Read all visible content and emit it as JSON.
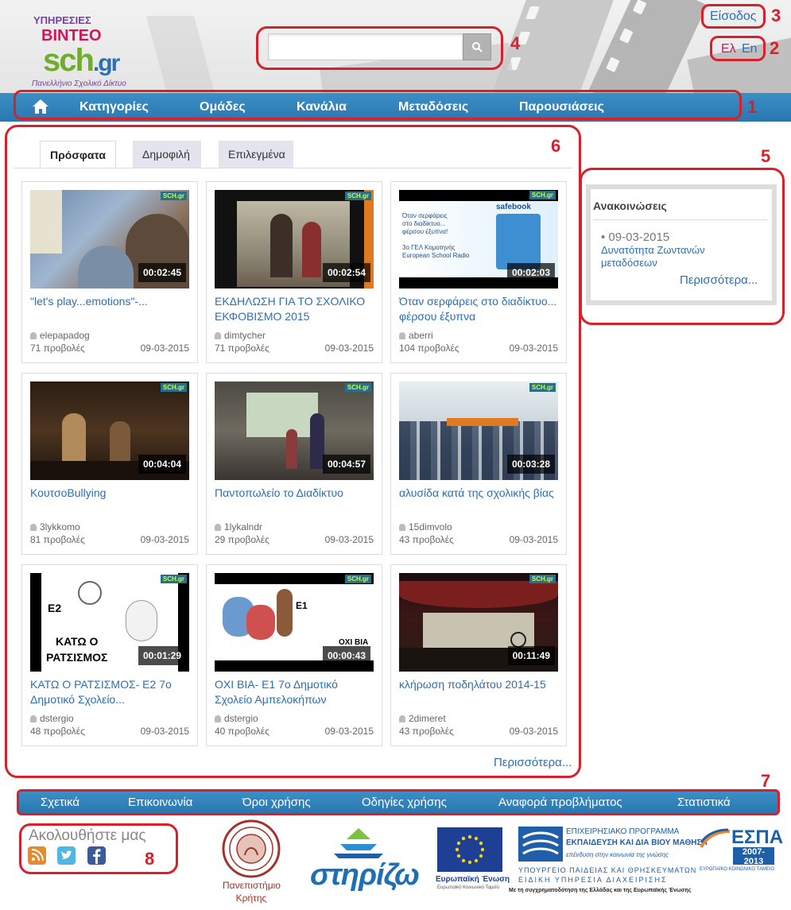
{
  "logo": {
    "line1": "ΥΠΗΡΕΣΙΕΣ",
    "line2": "ΒΙΝΤΕΟ",
    "line3": "sch",
    "line3b": ".gr",
    "tagline": "Πανελλήνιο Σχολικό Δίκτυο"
  },
  "header": {
    "login_label": "Είσοδος",
    "lang_el": "Ελ",
    "lang_en": "En",
    "search_placeholder": ""
  },
  "nav": {
    "items": [
      "Κατηγορίες",
      "Ομάδες",
      "Κανάλια",
      "Μεταδόσεις",
      "Παρουσιάσεις"
    ]
  },
  "tabs": [
    {
      "label": "Πρόσφατα",
      "active": true
    },
    {
      "label": "Δημοφιλή",
      "active": false
    },
    {
      "label": "Επιλεγμένα",
      "active": false
    }
  ],
  "videos": [
    {
      "title": "\"let's play...emotions\"-...",
      "author": "elepapadog",
      "views": "71 προβολές",
      "date": "09-03-2015",
      "duration": "00:02:45"
    },
    {
      "title": "ΕΚΔΗΛΩΣΗ ΓΙΑ ΤΟ ΣΧΟΛΙΚΟ ΕΚΦΟΒΙΣΜΟ 2015",
      "author": "dimtycher",
      "views": "71 προβολές",
      "date": "09-03-2015",
      "duration": "00:02:54"
    },
    {
      "title": "Όταν σερφάρεις στο διαδίκτυο... φέρσου έξυπνα",
      "author": "aberri",
      "views": "104 προβολές",
      "date": "09-03-2015",
      "duration": "00:02:03"
    },
    {
      "title": "ΚουτσοBullying",
      "author": "3lykkomo",
      "views": "81 προβολές",
      "date": "09-03-2015",
      "duration": "00:04:04"
    },
    {
      "title": "Παντοπωλείο το Διαδίκτυο",
      "author": "1lykalndr",
      "views": "29 προβολές",
      "date": "09-03-2015",
      "duration": "00:04:57"
    },
    {
      "title": "αλυσίδα κατά της σχολικής βίας",
      "author": "15dimvolo",
      "views": "43 προβολές",
      "date": "09-03-2015",
      "duration": "00:03:28"
    },
    {
      "title": "ΚΑΤΩ Ο ΡΑΤΣΙΣΜΟΣ- Ε2 7ο Δημοτικό Σχολείο...",
      "author": "dstergio",
      "views": "48 προβολές",
      "date": "09-03-2015",
      "duration": "00:01:29"
    },
    {
      "title": "ΟΧΙ ΒΙΑ- Ε1 7ο Δημοτικό Σχολείο Αμπελοκήπων",
      "author": "dstergio",
      "views": "40 προβολές",
      "date": "09-03-2015",
      "duration": "00:00:43"
    },
    {
      "title": "κλήρωση ποδηλάτου 2014-15",
      "author": "2dimeret",
      "views": "43 προβολές",
      "date": "09-03-2015",
      "duration": "00:11:49"
    }
  ],
  "thumb_text": {
    "badge": "SCH.gr",
    "v3_brand": "safebook",
    "v3_line1": "Όταν σερφάρεις",
    "v3_line2": "στο διαδίκτυο...",
    "v3_line3": "φέρσου έξυπνα!",
    "v3_line4": "3ο ΓΕΛ Κομοτηνής",
    "v3_line5": "European School Radio",
    "v7_label": "Ε2",
    "v7_text1": "ΚΑΤΩ Ο",
    "v7_text2": "ΡΑΤΣΙΣΜΟΣ",
    "v8_label": "Ε1",
    "v8_text": "ΟΧΙ ΒΙΑ"
  },
  "more_videos": "Περισσότερα...",
  "announcements": {
    "title": "Ανακοινώσεις",
    "date": "• 09-03-2015",
    "text": "Δυνατότητα Ζωντανών μεταδόσεων",
    "more": "Περισσότερα..."
  },
  "footer": {
    "links": [
      "Σχετικά",
      "Επικοινωνία",
      "Όροι χρήσης",
      "Οδηγίες χρήσης",
      "Αναφορά προβλήματος",
      "Στατιστικά"
    ],
    "follow": "Ακολουθήστε μας",
    "uoc": "Πανεπιστήμιο Κρήτης",
    "stirizo": "στηρίζω",
    "eu": "Ευρωπαϊκή Ένωση",
    "eu_sub": "Ευρωπαϊκό Κοινωνικό Ταμείο",
    "edu_t1": "ΕΠΙΧΕΙΡΗΣΙΑΚΟ ΠΡΟΓΡΑΜΜΑ",
    "edu_t2": "ΕΚΠΑΙΔΕΥΣΗ ΚΑΙ ΔΙΑ ΒΙΟΥ ΜΑΘΗΣΗ",
    "edu_t3": "επένδυση στην κοινωνία της γνώσης",
    "edu_t4": "ΥΠΟΥΡΓΕΙΟ ΠΑΙΔΕΙΑΣ ΚΑΙ ΘΡΗΣΚΕΥΜΑΤΩΝ",
    "edu_t5": "ΕΙΔΙΚΗ ΥΠΗΡΕΣΙΑ ΔΙΑΧΕΙΡΙΣΗΣ",
    "cofund": "Με τη συγχρηματοδότηση της Ελλάδας και της Ευρωπαϊκής Ένωσης",
    "espa": "ΕΣΠΑ",
    "espa_years": "2007-2013",
    "espa_sub": "ΕΥΡΩΠΑΪΚΟ ΚΟΙΝΩΝΙΚΟ ΤΑΜΕΙΟ"
  },
  "annotations": [
    "1",
    "2",
    "3",
    "4",
    "5",
    "6",
    "7",
    "8"
  ],
  "colors": {
    "accent": "#2a77b0",
    "link": "#2c6fb3",
    "annotation": "#d8202a"
  }
}
